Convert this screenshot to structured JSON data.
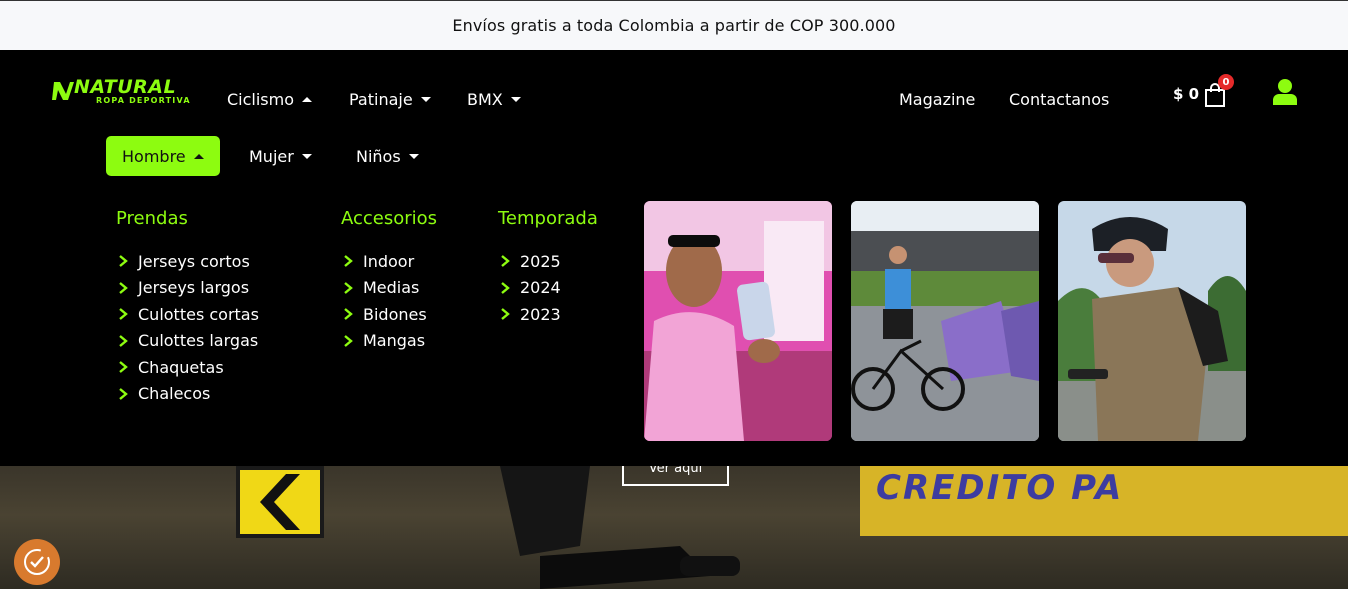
{
  "announcement": "Envíos gratis a toda Colombia a partir de COP 300.000",
  "brand": {
    "name": "NATURAL",
    "tagline": "ROPA DEPORTIVA",
    "accent": "#8dfc10"
  },
  "topnav": {
    "left": [
      {
        "label": "Ciclismo",
        "caret": "up"
      },
      {
        "label": "Patinaje",
        "caret": "down"
      },
      {
        "label": "BMX",
        "caret": "down"
      }
    ],
    "right": [
      {
        "label": "Magazine"
      },
      {
        "label": "Contactanos"
      }
    ]
  },
  "cart": {
    "total": "$ 0",
    "count": "0",
    "icon": "shopping-bag-icon"
  },
  "account": {
    "icon": "user-icon"
  },
  "subnav": [
    {
      "label": "Hombre",
      "active": true
    },
    {
      "label": "Mujer",
      "active": false
    },
    {
      "label": "Niños",
      "active": false
    }
  ],
  "mega": {
    "prendas": {
      "title": "Prendas",
      "items": [
        "Jerseys cortos",
        "Jerseys largos",
        "Culottes cortas",
        "Culottes largas",
        "Chaquetas",
        "Chalecos"
      ]
    },
    "accesorios": {
      "title": "Accesorios",
      "items": [
        "Indoor",
        "Medias",
        "Bidones",
        "Mangas"
      ]
    },
    "temporada": {
      "title": "Temporada",
      "items": [
        "2025",
        "2024",
        "2023"
      ]
    }
  },
  "hero": {
    "button": "Ver aquí",
    "wall_text": "CREDITO PA"
  },
  "cookie": {
    "icon": "cookie-consent-icon"
  }
}
